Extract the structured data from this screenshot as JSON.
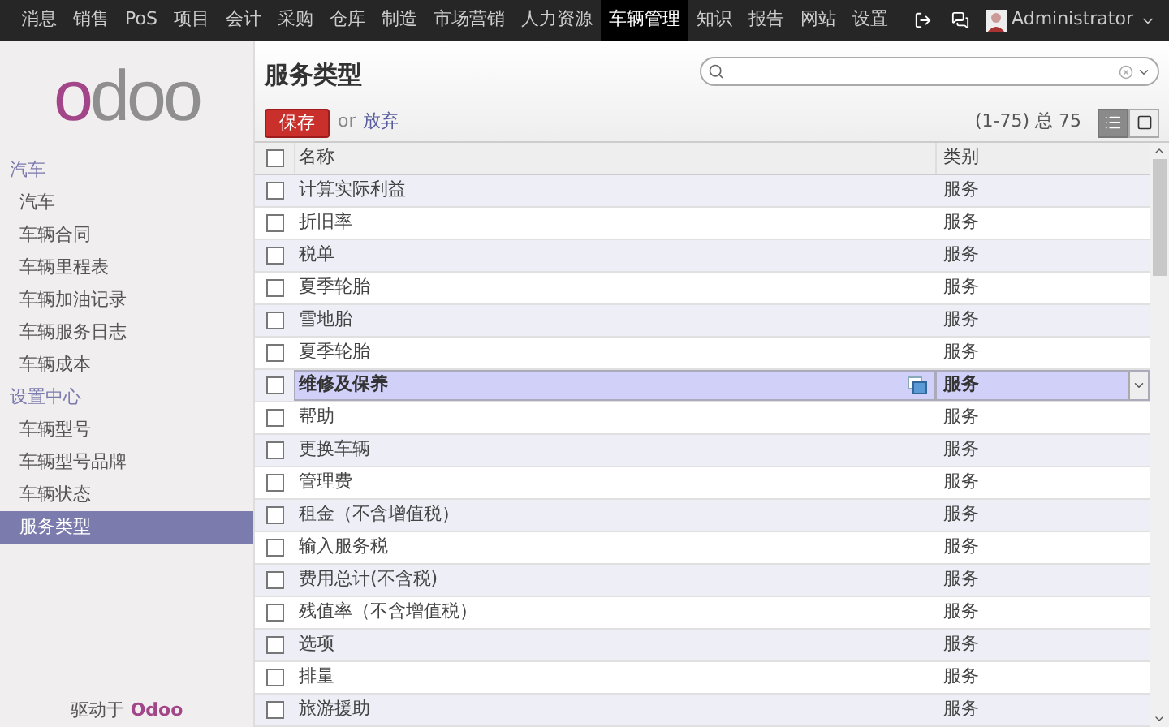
{
  "top_menu": [
    {
      "label": "消息",
      "selected": false
    },
    {
      "label": "销售",
      "selected": false
    },
    {
      "label": "PoS",
      "selected": false
    },
    {
      "label": "项目",
      "selected": false
    },
    {
      "label": "会计",
      "selected": false
    },
    {
      "label": "采购",
      "selected": false
    },
    {
      "label": "仓库",
      "selected": false
    },
    {
      "label": "制造",
      "selected": false
    },
    {
      "label": "市场营销",
      "selected": false
    },
    {
      "label": "人力资源",
      "selected": false
    },
    {
      "label": "车辆管理",
      "selected": true
    },
    {
      "label": "知识",
      "selected": false
    },
    {
      "label": "报告",
      "selected": false
    },
    {
      "label": "网站",
      "selected": false
    },
    {
      "label": "设置",
      "selected": false
    }
  ],
  "user": {
    "name": "Administrator"
  },
  "logo": {
    "first": "o",
    "rest": "doo"
  },
  "sidebar": {
    "sections": [
      {
        "title": "汽车",
        "items": [
          {
            "label": "汽车",
            "selected": false
          },
          {
            "label": "车辆合同",
            "selected": false
          },
          {
            "label": "车辆里程表",
            "selected": false
          },
          {
            "label": "车辆加油记录",
            "selected": false
          },
          {
            "label": "车辆服务日志",
            "selected": false
          },
          {
            "label": "车辆成本",
            "selected": false
          }
        ]
      },
      {
        "title": "设置中心",
        "items": [
          {
            "label": "车辆型号",
            "selected": false
          },
          {
            "label": "车辆型号品牌",
            "selected": false
          },
          {
            "label": "车辆状态",
            "selected": false
          },
          {
            "label": "服务类型",
            "selected": true
          }
        ]
      }
    ],
    "footer": {
      "prefix": "驱动于",
      "brand": "Odoo"
    }
  },
  "page": {
    "title": "服务类型",
    "save": "保存",
    "or": "or",
    "discard": "放弃",
    "pager": "(1-75) 总 75"
  },
  "table": {
    "columns": [
      "名称",
      "类别"
    ],
    "all_checked": false,
    "rows": [
      {
        "kind": "view",
        "checked": false,
        "name": "计算实际利益",
        "category": "服务"
      },
      {
        "kind": "view",
        "checked": false,
        "name": "折旧率",
        "category": "服务"
      },
      {
        "kind": "view",
        "checked": false,
        "name": "税单",
        "category": "服务"
      },
      {
        "kind": "view",
        "checked": false,
        "name": "夏季轮胎",
        "category": "服务"
      },
      {
        "kind": "view",
        "checked": false,
        "name": "雪地胎",
        "category": "服务"
      },
      {
        "kind": "view",
        "checked": false,
        "name": "夏季轮胎",
        "category": "服务"
      },
      {
        "kind": "edit",
        "checked": false,
        "name": "维修及保养",
        "category": "服务"
      },
      {
        "kind": "view",
        "checked": false,
        "name": "帮助",
        "category": "服务"
      },
      {
        "kind": "view",
        "checked": false,
        "name": "更换车辆",
        "category": "服务"
      },
      {
        "kind": "view",
        "checked": false,
        "name": "管理费",
        "category": "服务"
      },
      {
        "kind": "view",
        "checked": false,
        "name": "租金（不含增值税）",
        "category": "服务"
      },
      {
        "kind": "view",
        "checked": false,
        "name": "输入服务税",
        "category": "服务"
      },
      {
        "kind": "view",
        "checked": false,
        "name": "费用总计(不含税)",
        "category": "服务"
      },
      {
        "kind": "view",
        "checked": false,
        "name": "残值率（不含增值税）",
        "category": "服务"
      },
      {
        "kind": "view",
        "checked": false,
        "name": "选项",
        "category": "服务"
      },
      {
        "kind": "view",
        "checked": false,
        "name": "排量",
        "category": "服务"
      },
      {
        "kind": "view",
        "checked": false,
        "name": "旅游援助",
        "category": "服务"
      }
    ]
  }
}
